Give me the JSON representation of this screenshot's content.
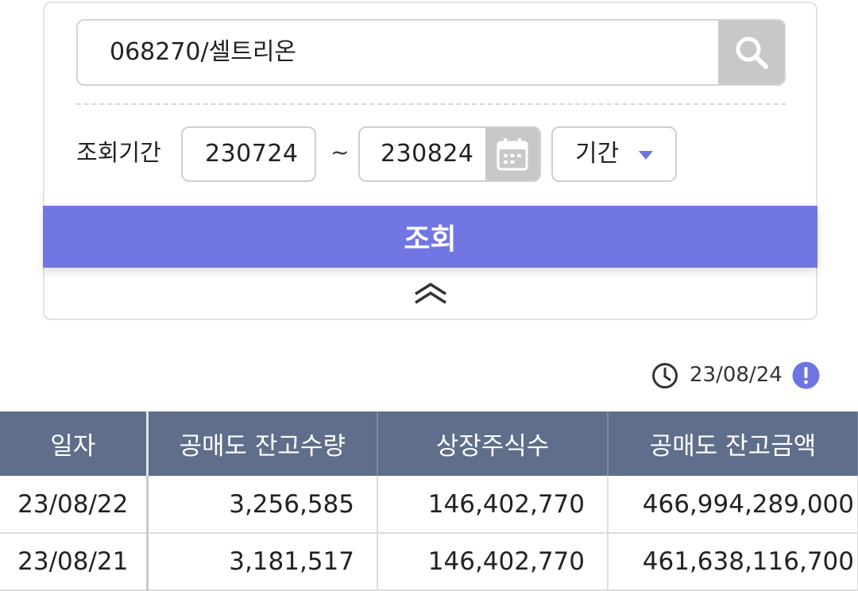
{
  "search": {
    "value": "068270/셀트리온",
    "button_icon": "search-icon"
  },
  "period": {
    "label": "조회기간",
    "start": "230724",
    "separator": "~",
    "end": "230824",
    "calendar_icon": "calendar-icon",
    "select_value": "기간"
  },
  "submit_label": "조회",
  "timestamp": "23/08/24",
  "colors": {
    "accent": "#7276e2",
    "table_header": "#5f6e8a"
  },
  "table": {
    "headers": [
      "일자",
      "공매도 잔고수량",
      "상장주식수",
      "공매도 잔고금액"
    ],
    "rows": [
      [
        "23/08/22",
        "3,256,585",
        "146,402,770",
        "466,994,289,000"
      ],
      [
        "23/08/21",
        "3,181,517",
        "146,402,770",
        "461,638,116,700"
      ]
    ]
  }
}
